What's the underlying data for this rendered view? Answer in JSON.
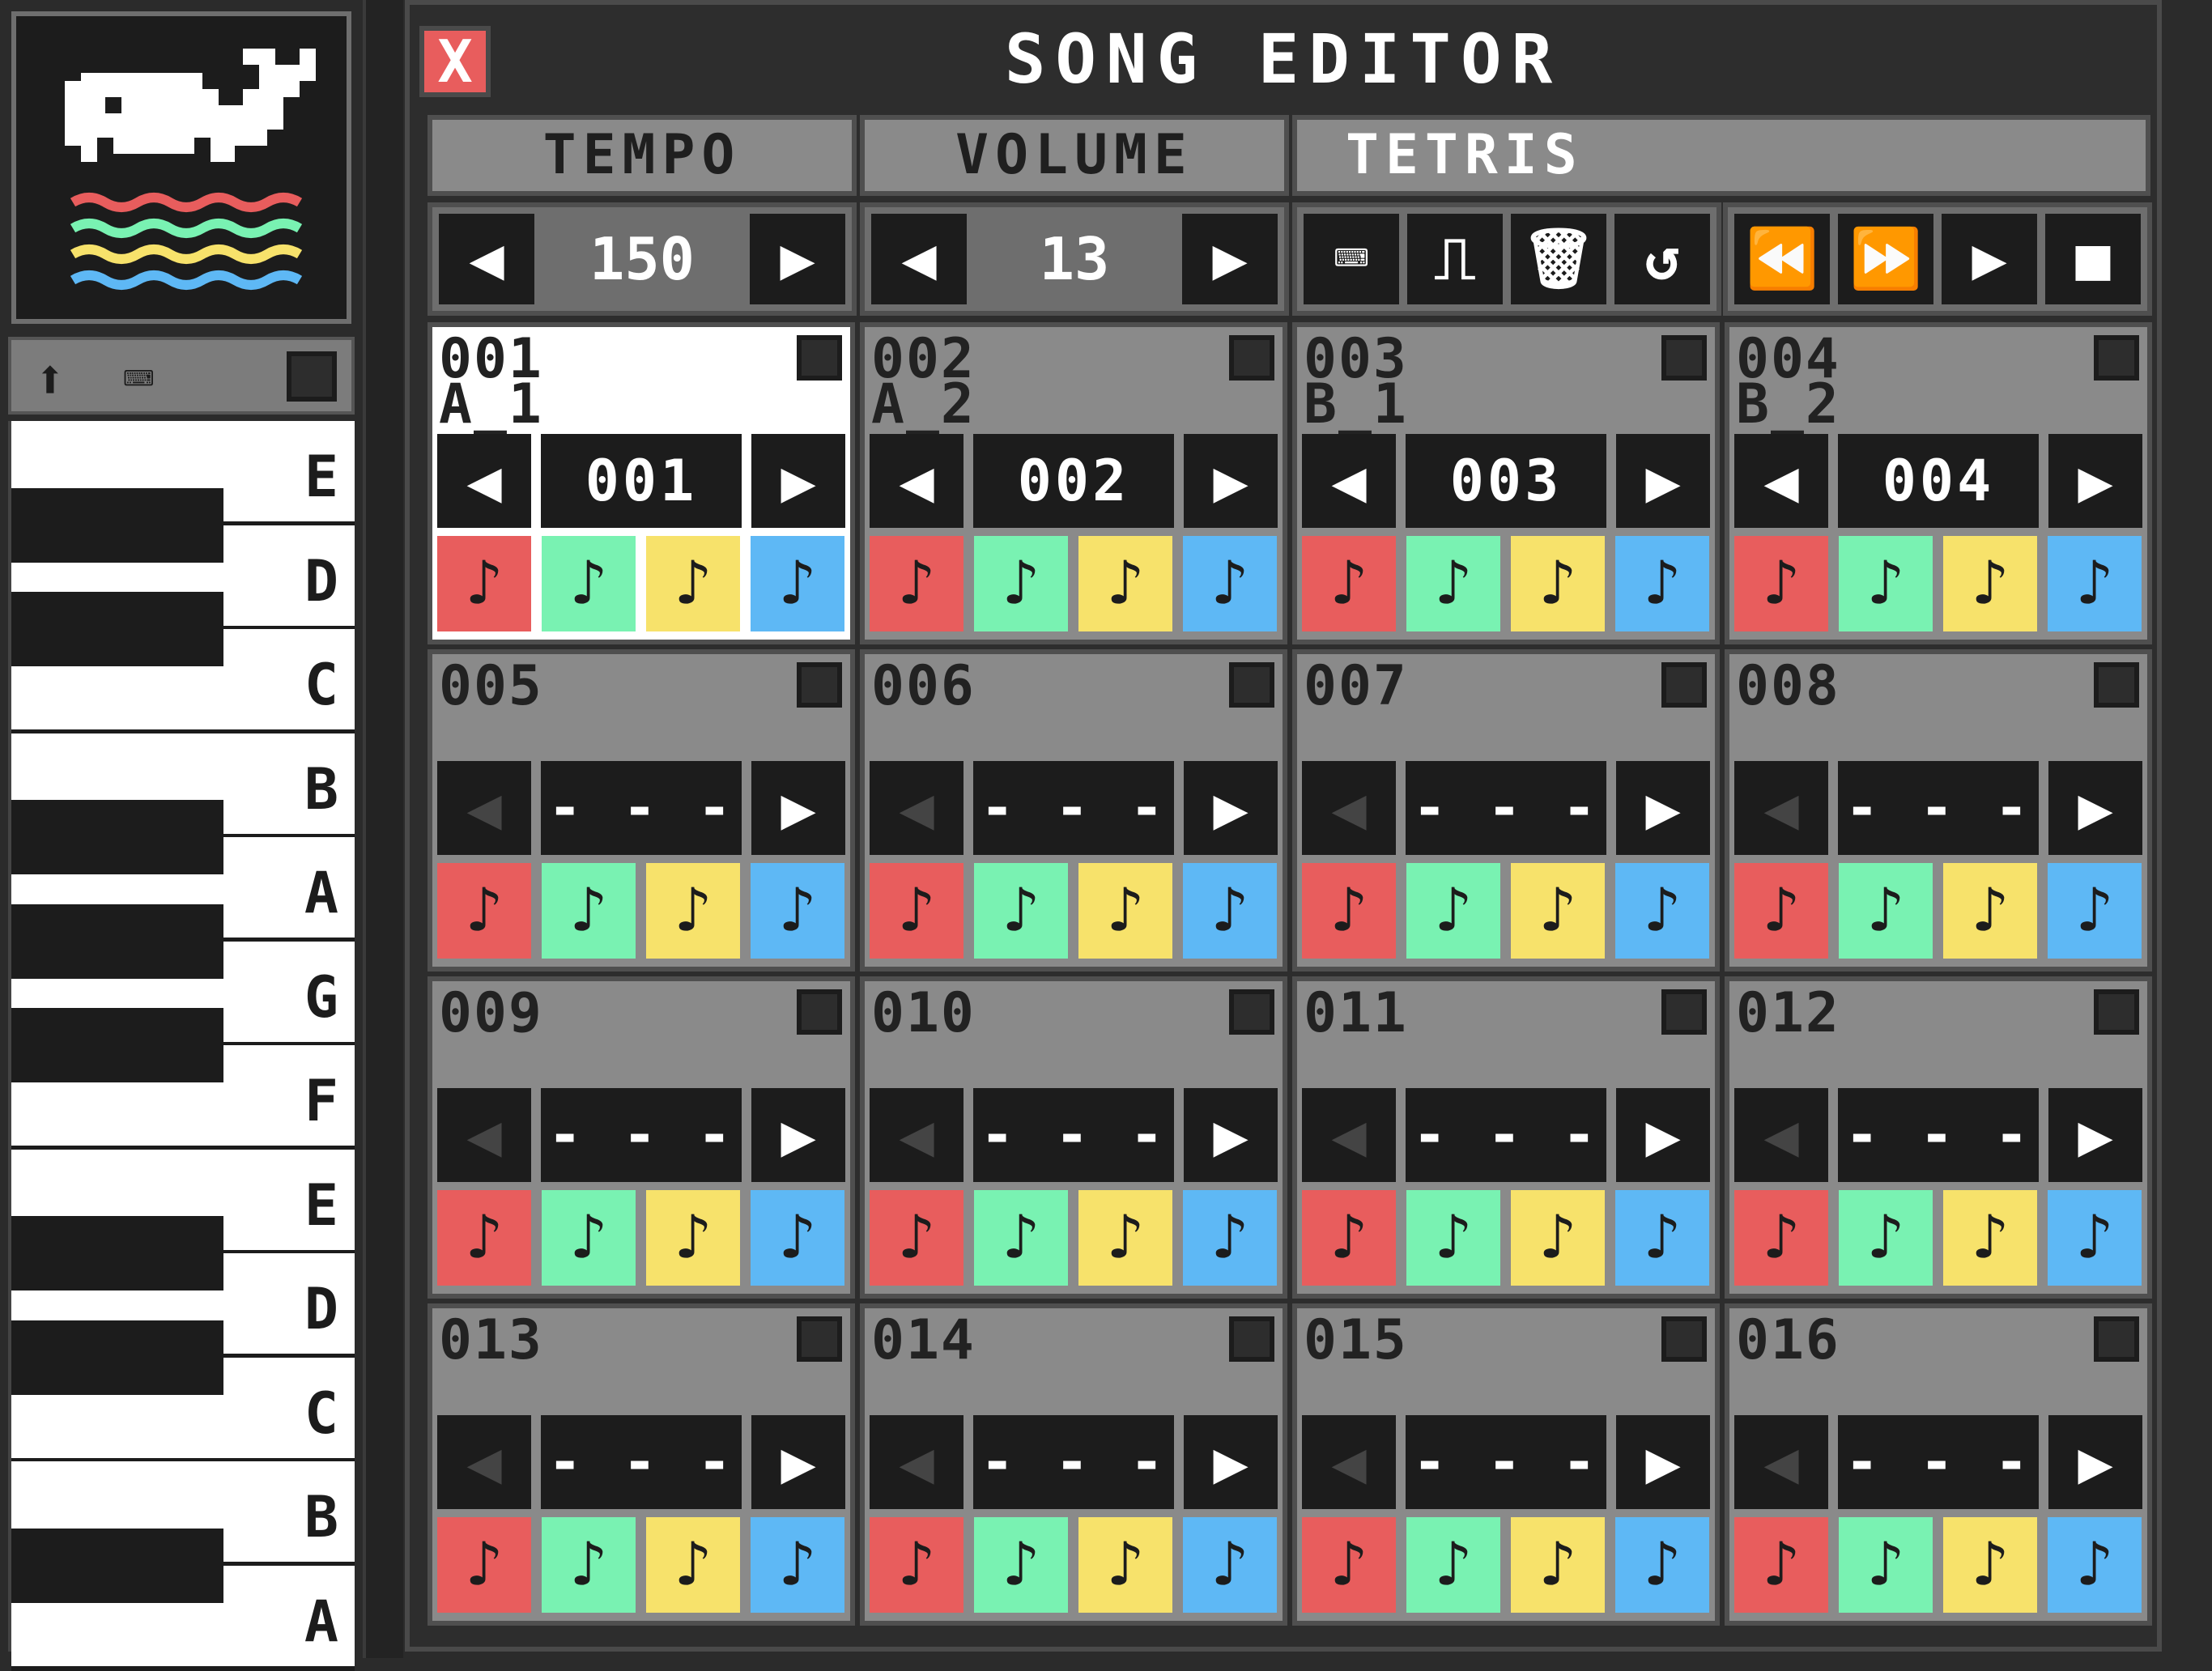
{
  "window": {
    "title": "SONG EDITOR",
    "close_label": "X"
  },
  "headers": {
    "tempo": "TEMPO",
    "volume": "VOLUME",
    "song": "TETRIS"
  },
  "tempo": {
    "value": "150",
    "left": "◀",
    "right": "▶"
  },
  "volume": {
    "value": "13",
    "left": "◀",
    "right": "▶"
  },
  "tools": [
    {
      "icon": "piano-icon",
      "glyph": "⌨"
    },
    {
      "icon": "waveform-icon",
      "glyph": "⎍"
    },
    {
      "icon": "trash-icon",
      "glyph": "🗑"
    },
    {
      "icon": "undo-icon",
      "glyph": "↺"
    }
  ],
  "transport": [
    {
      "icon": "rewind-icon",
      "glyph": "⏪"
    },
    {
      "icon": "fast-forward-icon",
      "glyph": "⏩"
    },
    {
      "icon": "play-icon",
      "glyph": "▶"
    },
    {
      "icon": "stop-icon",
      "glyph": "■"
    }
  ],
  "piano": {
    "keys": [
      "E",
      "D",
      "C",
      "B",
      "A",
      "G",
      "F",
      "E",
      "D",
      "C",
      "B",
      "A"
    ],
    "toolbar": {
      "up_icon": "up-arrow-icon",
      "keyboard_icon": "piano-icon"
    }
  },
  "channel_colors": [
    "#e85d5d",
    "#79f2b2",
    "#f7e26b",
    "#5eb8f5"
  ],
  "patterns": [
    {
      "num": "001",
      "name": "A_1",
      "value": "001",
      "active": true,
      "left_enabled": true
    },
    {
      "num": "002",
      "name": "A_2",
      "value": "002",
      "active": false,
      "left_enabled": true
    },
    {
      "num": "003",
      "name": "B_1",
      "value": "003",
      "active": false,
      "left_enabled": true
    },
    {
      "num": "004",
      "name": "B_2",
      "value": "004",
      "active": false,
      "left_enabled": true
    },
    {
      "num": "005",
      "name": "",
      "value": "- - -",
      "active": false,
      "left_enabled": false
    },
    {
      "num": "006",
      "name": "",
      "value": "- - -",
      "active": false,
      "left_enabled": false
    },
    {
      "num": "007",
      "name": "",
      "value": "- - -",
      "active": false,
      "left_enabled": false
    },
    {
      "num": "008",
      "name": "",
      "value": "- - -",
      "active": false,
      "left_enabled": false
    },
    {
      "num": "009",
      "name": "",
      "value": "- - -",
      "active": false,
      "left_enabled": false
    },
    {
      "num": "010",
      "name": "",
      "value": "- - -",
      "active": false,
      "left_enabled": false
    },
    {
      "num": "011",
      "name": "",
      "value": "- - -",
      "active": false,
      "left_enabled": false
    },
    {
      "num": "012",
      "name": "",
      "value": "- - -",
      "active": false,
      "left_enabled": false
    },
    {
      "num": "013",
      "name": "",
      "value": "- - -",
      "active": false,
      "left_enabled": false
    },
    {
      "num": "014",
      "name": "",
      "value": "- - -",
      "active": false,
      "left_enabled": false
    },
    {
      "num": "015",
      "name": "",
      "value": "- - -",
      "active": false,
      "left_enabled": false
    },
    {
      "num": "016",
      "name": "",
      "value": "- - -",
      "active": false,
      "left_enabled": false
    }
  ]
}
